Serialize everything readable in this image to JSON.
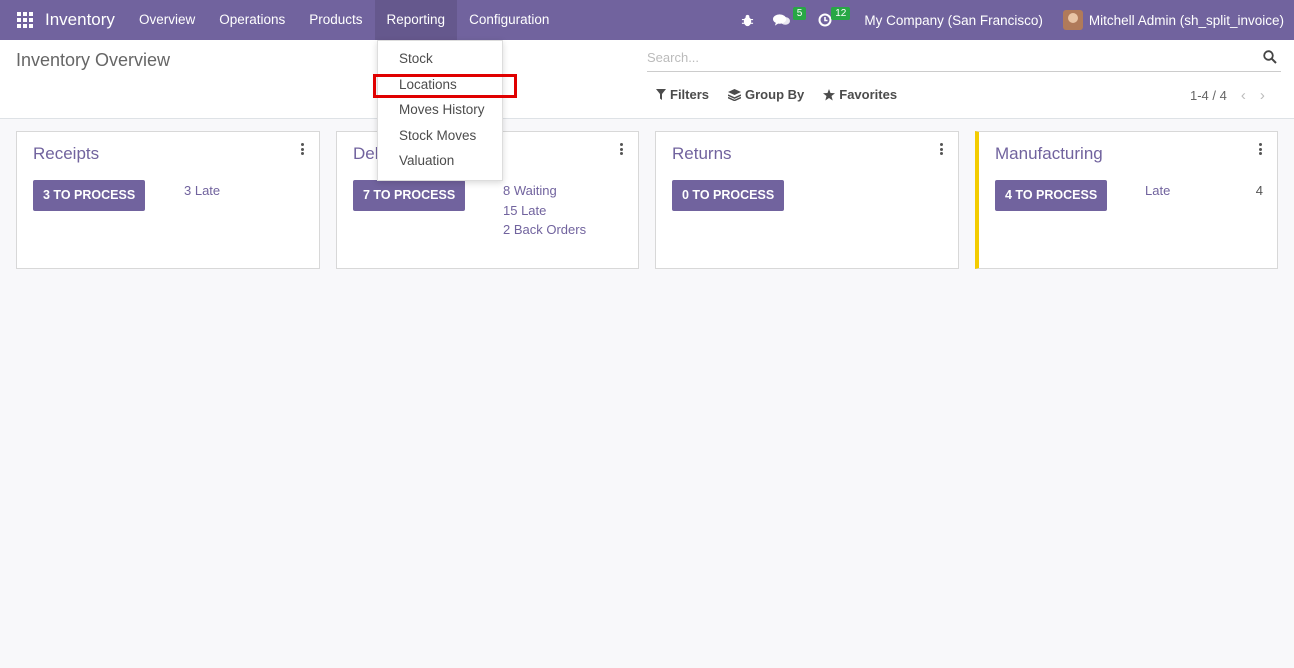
{
  "navbar": {
    "app_title": "Inventory",
    "menu": [
      "Overview",
      "Operations",
      "Products",
      "Reporting",
      "Configuration"
    ],
    "active_menu": "Reporting",
    "messages_count": "5",
    "activities_count": "12",
    "company": "My Company (San Francisco)",
    "user": "Mitchell Admin (sh_split_invoice)",
    "badge_color": "#28a745",
    "brand_color": "#71639e"
  },
  "control_panel": {
    "title": "Inventory Overview",
    "search_placeholder": "Search...",
    "filters_label": "Filters",
    "group_by_label": "Group By",
    "favorites_label": "Favorites",
    "pager": "1-4 / 4"
  },
  "dropdown": {
    "items": [
      "Stock",
      "Locations",
      "Moves History",
      "Stock Moves",
      "Valuation"
    ],
    "highlighted": "Locations"
  },
  "cards": [
    {
      "title": "Receipts",
      "button": "3 TO PROCESS",
      "links": [
        "3 Late"
      ]
    },
    {
      "title": "Delivery Orders",
      "visible_title": "Del",
      "button": "7 TO PROCESS",
      "links": [
        "8 Waiting",
        "15 Late",
        "2 Back Orders"
      ]
    },
    {
      "title": "Returns",
      "button": "0 TO PROCESS",
      "links": []
    },
    {
      "title": "Manufacturing",
      "button": "4 TO PROCESS",
      "links": [
        "Late"
      ],
      "late_count": "4",
      "accent_color": "#f3cc00"
    }
  ],
  "highlight_color": "#e00000"
}
